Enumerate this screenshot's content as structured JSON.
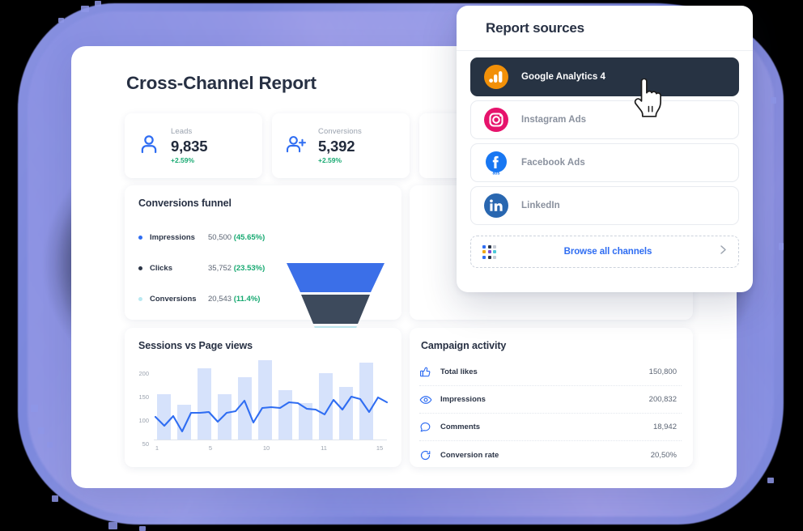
{
  "dashboard": {
    "title": "Cross-Channel Report",
    "kpis": [
      {
        "label": "Leads",
        "value": "9,835",
        "delta": "+2.59%",
        "icon": "user-icon"
      },
      {
        "label": "Conversions",
        "value": "5,392",
        "delta": "+2.59%",
        "icon": "user-plus-icon"
      },
      {
        "label": "",
        "value": "",
        "delta": "",
        "icon": ""
      }
    ],
    "funnel_panel": {
      "title": "Conversions funnel",
      "rows": [
        {
          "name": "Impressions",
          "value": "50,500",
          "percent": "(45.65%)",
          "color": "#2f6df2"
        },
        {
          "name": "Clicks",
          "value": "35,752",
          "percent": "(23.53%)",
          "color": "#2c3547"
        },
        {
          "name": "Conversions",
          "value": "20,543",
          "percent": "(11.4%)",
          "color": "#b9e8f1"
        }
      ]
    },
    "sessions_panel": {
      "title": "Sessions vs Page views"
    },
    "campaign_panel": {
      "title": "Campaign activity",
      "rows": [
        {
          "name": "Total likes",
          "value": "150,800",
          "icon": "thumbs-up-icon"
        },
        {
          "name": "Impressions",
          "value": "200,832",
          "icon": "eye-icon"
        },
        {
          "name": "Comments",
          "value": "18,942",
          "icon": "comment-icon"
        },
        {
          "name": "Conversion rate",
          "value": "20,50%",
          "icon": "refresh-icon"
        }
      ]
    }
  },
  "popup": {
    "title": "Report sources",
    "sources": [
      {
        "label": "Google Analytics 4",
        "icon": "google-analytics-icon",
        "selected": true
      },
      {
        "label": "Instagram Ads",
        "icon": "instagram-icon",
        "selected": false
      },
      {
        "label": "Facebook Ads",
        "icon": "facebook-ads-icon",
        "selected": false
      },
      {
        "label": "LinkedIn",
        "icon": "linkedin-icon",
        "selected": false
      }
    ],
    "browse": {
      "label": "Browse all channels",
      "icon": "grid-dots-icon",
      "chevron": "chevron-right-icon"
    }
  },
  "colors": {
    "accent": "#2f6df2",
    "positive": "#17a971",
    "dark": "#273343",
    "funnel_top": "#3b6fe8",
    "funnel_mid": "#3d4a5c",
    "funnel_bottom": "#bfe9f0",
    "bar": "#d6e2fb",
    "line": "#2f6df2"
  },
  "chart_data": {
    "type": "bar",
    "title": "Sessions vs Page views",
    "xlabel": "",
    "ylabel": "",
    "ylim": [
      50,
      230
    ],
    "yticks": [
      50,
      100,
      150,
      200
    ],
    "x": [
      1,
      2,
      3,
      4,
      5,
      6,
      7,
      8,
      9,
      10,
      11,
      12,
      13,
      14,
      15
    ],
    "xtick_labels": [
      "1",
      "5",
      "10",
      "11",
      "15"
    ],
    "xtick_positions": [
      1,
      5,
      10,
      11,
      15
    ],
    "grid": false,
    "legend": "none",
    "series": [
      {
        "name": "Page views",
        "type": "bar",
        "values": [
          145,
          123,
          0,
          199,
          0,
          145,
          0,
          180,
          0,
          218,
          152,
          0,
          126,
          187,
          158,
          0,
          213
        ],
        "bar_values": [
          145,
          123,
          199,
          145,
          180,
          218,
          152,
          126,
          187,
          158,
          213
        ]
      },
      {
        "name": "Sessions",
        "type": "line",
        "values": [
          100,
          88,
          101,
          80,
          105,
          105,
          106,
          94,
          105,
          107,
          124,
          94,
          111,
          112,
          111,
          120,
          119,
          112,
          111,
          105,
          123,
          111,
          128,
          125,
          107,
          128,
          123
        ]
      }
    ]
  }
}
